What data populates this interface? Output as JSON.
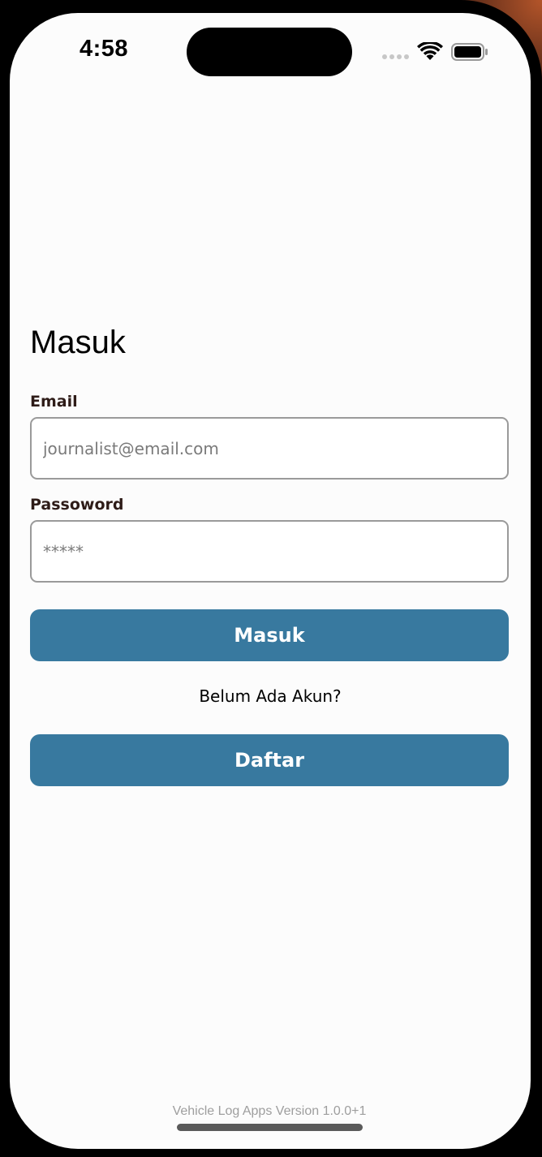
{
  "status_bar": {
    "time": "4:58"
  },
  "login": {
    "title": "Masuk",
    "email_label": "Email",
    "email_placeholder": "journalist@email.com",
    "email_value": "",
    "password_label": "Passoword",
    "password_placeholder": "*****",
    "password_value": "",
    "login_button": "Masuk",
    "no_account_prompt": "Belum Ada Akun?",
    "register_button": "Daftar"
  },
  "footer": {
    "version": "Vehicle Log Apps Version 1.0.0+1"
  },
  "colors": {
    "button_bg": "#38799f",
    "button_text": "#ffffff",
    "label_text": "#2e1c18",
    "screen_bg": "#fcfcfc"
  },
  "icons": {
    "wifi": "wifi-icon",
    "battery": "battery-icon",
    "signal": "cellular-signal-icon"
  }
}
